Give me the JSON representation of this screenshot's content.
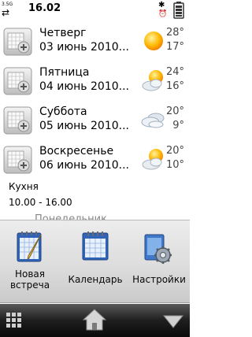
{
  "status": {
    "signal_label": "3.5G",
    "arrows": "⇄",
    "time": "16.02",
    "bluetooth": "✱",
    "alarm": "⏰"
  },
  "days": [
    {
      "name": "Четверг",
      "date": "03 июнь 2010...",
      "high": "28°",
      "low": "17°",
      "weather_icon": "sun-icon"
    },
    {
      "name": "Пятница",
      "date": "04 июнь 2010...",
      "high": "24°",
      "low": "16°",
      "weather_icon": "partly-cloudy-icon"
    },
    {
      "name": "Суббота",
      "date": "05 июнь 2010...",
      "high": "20°",
      "low": "9°",
      "weather_icon": "cloudy-icon"
    },
    {
      "name": "Воскресенье",
      "date": "06 июнь 2010...",
      "high": "20°",
      "low": "10°",
      "weather_icon": "partly-cloudy-icon"
    }
  ],
  "event": {
    "title": "Кухня",
    "time": "10.00 - 16.00"
  },
  "next_day_partial": "Понедельник",
  "shortcuts": {
    "new_meeting_line1": "Новая",
    "new_meeting_line2": "встреча",
    "calendar": "Календарь",
    "settings": "Настройки"
  },
  "nav": {
    "menu_icon": "grid-icon",
    "home_icon": "home-icon",
    "options_icon": "triangle-down-icon"
  }
}
